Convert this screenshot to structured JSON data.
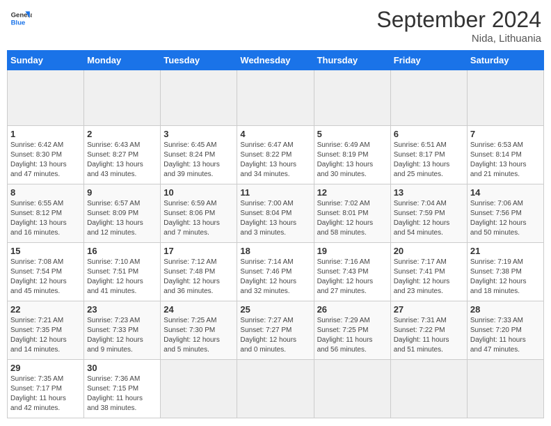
{
  "header": {
    "logo_line1": "General",
    "logo_line2": "Blue",
    "title": "September 2024",
    "location": "Nida, Lithuania"
  },
  "calendar": {
    "days_of_week": [
      "Sunday",
      "Monday",
      "Tuesday",
      "Wednesday",
      "Thursday",
      "Friday",
      "Saturday"
    ],
    "weeks": [
      [
        {
          "day": "",
          "data": ""
        },
        {
          "day": "",
          "data": ""
        },
        {
          "day": "",
          "data": ""
        },
        {
          "day": "",
          "data": ""
        },
        {
          "day": "",
          "data": ""
        },
        {
          "day": "",
          "data": ""
        },
        {
          "day": "",
          "data": ""
        }
      ],
      [
        {
          "day": "1",
          "data": "Sunrise: 6:42 AM\nSunset: 8:30 PM\nDaylight: 13 hours\nand 47 minutes."
        },
        {
          "day": "2",
          "data": "Sunrise: 6:43 AM\nSunset: 8:27 PM\nDaylight: 13 hours\nand 43 minutes."
        },
        {
          "day": "3",
          "data": "Sunrise: 6:45 AM\nSunset: 8:24 PM\nDaylight: 13 hours\nand 39 minutes."
        },
        {
          "day": "4",
          "data": "Sunrise: 6:47 AM\nSunset: 8:22 PM\nDaylight: 13 hours\nand 34 minutes."
        },
        {
          "day": "5",
          "data": "Sunrise: 6:49 AM\nSunset: 8:19 PM\nDaylight: 13 hours\nand 30 minutes."
        },
        {
          "day": "6",
          "data": "Sunrise: 6:51 AM\nSunset: 8:17 PM\nDaylight: 13 hours\nand 25 minutes."
        },
        {
          "day": "7",
          "data": "Sunrise: 6:53 AM\nSunset: 8:14 PM\nDaylight: 13 hours\nand 21 minutes."
        }
      ],
      [
        {
          "day": "8",
          "data": "Sunrise: 6:55 AM\nSunset: 8:12 PM\nDaylight: 13 hours\nand 16 minutes."
        },
        {
          "day": "9",
          "data": "Sunrise: 6:57 AM\nSunset: 8:09 PM\nDaylight: 13 hours\nand 12 minutes."
        },
        {
          "day": "10",
          "data": "Sunrise: 6:59 AM\nSunset: 8:06 PM\nDaylight: 13 hours\nand 7 minutes."
        },
        {
          "day": "11",
          "data": "Sunrise: 7:00 AM\nSunset: 8:04 PM\nDaylight: 13 hours\nand 3 minutes."
        },
        {
          "day": "12",
          "data": "Sunrise: 7:02 AM\nSunset: 8:01 PM\nDaylight: 12 hours\nand 58 minutes."
        },
        {
          "day": "13",
          "data": "Sunrise: 7:04 AM\nSunset: 7:59 PM\nDaylight: 12 hours\nand 54 minutes."
        },
        {
          "day": "14",
          "data": "Sunrise: 7:06 AM\nSunset: 7:56 PM\nDaylight: 12 hours\nand 50 minutes."
        }
      ],
      [
        {
          "day": "15",
          "data": "Sunrise: 7:08 AM\nSunset: 7:54 PM\nDaylight: 12 hours\nand 45 minutes."
        },
        {
          "day": "16",
          "data": "Sunrise: 7:10 AM\nSunset: 7:51 PM\nDaylight: 12 hours\nand 41 minutes."
        },
        {
          "day": "17",
          "data": "Sunrise: 7:12 AM\nSunset: 7:48 PM\nDaylight: 12 hours\nand 36 minutes."
        },
        {
          "day": "18",
          "data": "Sunrise: 7:14 AM\nSunset: 7:46 PM\nDaylight: 12 hours\nand 32 minutes."
        },
        {
          "day": "19",
          "data": "Sunrise: 7:16 AM\nSunset: 7:43 PM\nDaylight: 12 hours\nand 27 minutes."
        },
        {
          "day": "20",
          "data": "Sunrise: 7:17 AM\nSunset: 7:41 PM\nDaylight: 12 hours\nand 23 minutes."
        },
        {
          "day": "21",
          "data": "Sunrise: 7:19 AM\nSunset: 7:38 PM\nDaylight: 12 hours\nand 18 minutes."
        }
      ],
      [
        {
          "day": "22",
          "data": "Sunrise: 7:21 AM\nSunset: 7:35 PM\nDaylight: 12 hours\nand 14 minutes."
        },
        {
          "day": "23",
          "data": "Sunrise: 7:23 AM\nSunset: 7:33 PM\nDaylight: 12 hours\nand 9 minutes."
        },
        {
          "day": "24",
          "data": "Sunrise: 7:25 AM\nSunset: 7:30 PM\nDaylight: 12 hours\nand 5 minutes."
        },
        {
          "day": "25",
          "data": "Sunrise: 7:27 AM\nSunset: 7:27 PM\nDaylight: 12 hours\nand 0 minutes."
        },
        {
          "day": "26",
          "data": "Sunrise: 7:29 AM\nSunset: 7:25 PM\nDaylight: 11 hours\nand 56 minutes."
        },
        {
          "day": "27",
          "data": "Sunrise: 7:31 AM\nSunset: 7:22 PM\nDaylight: 11 hours\nand 51 minutes."
        },
        {
          "day": "28",
          "data": "Sunrise: 7:33 AM\nSunset: 7:20 PM\nDaylight: 11 hours\nand 47 minutes."
        }
      ],
      [
        {
          "day": "29",
          "data": "Sunrise: 7:35 AM\nSunset: 7:17 PM\nDaylight: 11 hours\nand 42 minutes."
        },
        {
          "day": "30",
          "data": "Sunrise: 7:36 AM\nSunset: 7:15 PM\nDaylight: 11 hours\nand 38 minutes."
        },
        {
          "day": "",
          "data": ""
        },
        {
          "day": "",
          "data": ""
        },
        {
          "day": "",
          "data": ""
        },
        {
          "day": "",
          "data": ""
        },
        {
          "day": "",
          "data": ""
        }
      ]
    ]
  }
}
